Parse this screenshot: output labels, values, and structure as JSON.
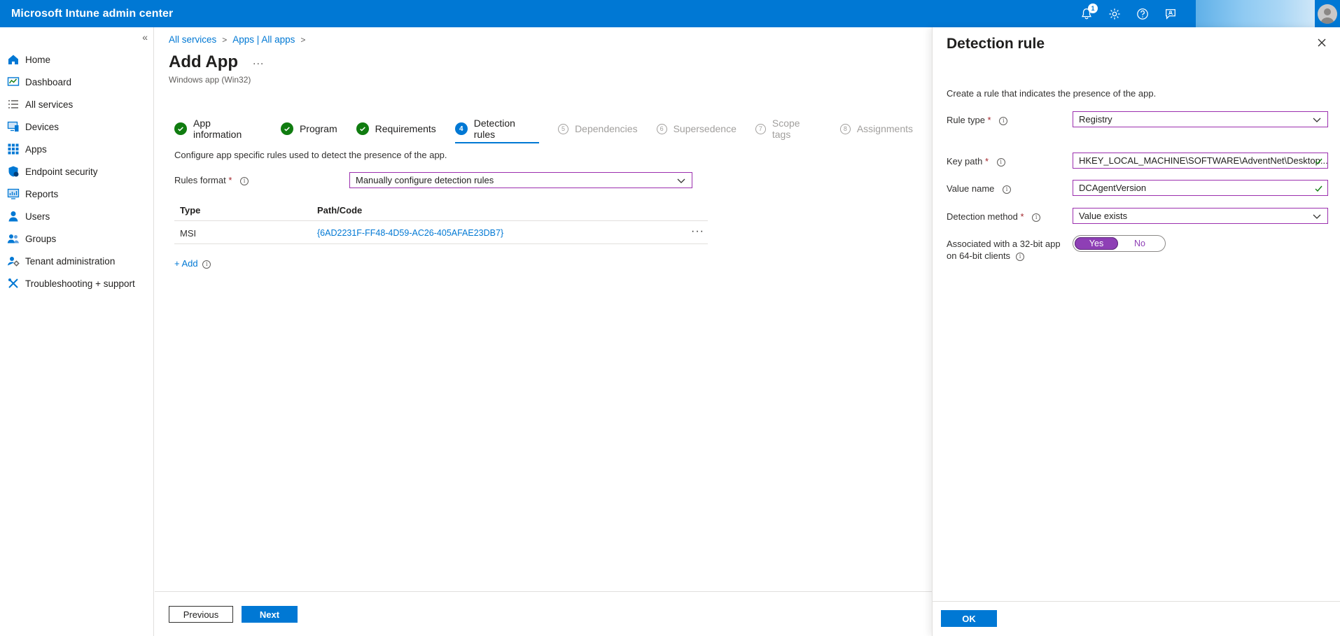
{
  "topbar": {
    "title": "Microsoft Intune admin center",
    "notification_count": "1",
    "icons": [
      "bell-icon",
      "gear-icon",
      "help-icon",
      "feedback-icon"
    ]
  },
  "sidebar": {
    "items": [
      {
        "label": "Home",
        "icon": "home-icon"
      },
      {
        "label": "Dashboard",
        "icon": "dashboard-icon"
      },
      {
        "label": "All services",
        "icon": "list-icon"
      },
      {
        "label": "Devices",
        "icon": "devices-icon"
      },
      {
        "label": "Apps",
        "icon": "apps-icon"
      },
      {
        "label": "Endpoint security",
        "icon": "shield-icon"
      },
      {
        "label": "Reports",
        "icon": "reports-icon"
      },
      {
        "label": "Users",
        "icon": "user-icon"
      },
      {
        "label": "Groups",
        "icon": "groups-icon"
      },
      {
        "label": "Tenant administration",
        "icon": "tenant-icon"
      },
      {
        "label": "Troubleshooting + support",
        "icon": "tools-icon"
      }
    ]
  },
  "breadcrumb": [
    "All services",
    "Apps | All apps"
  ],
  "page": {
    "title": "Add App",
    "subtitle": "Windows app (Win32)",
    "more": "..."
  },
  "steps": [
    {
      "label": "App information",
      "state": "done",
      "num": "1"
    },
    {
      "label": "Program",
      "state": "done",
      "num": "2"
    },
    {
      "label": "Requirements",
      "state": "done",
      "num": "3"
    },
    {
      "label": "Detection rules",
      "state": "active",
      "num": "4"
    },
    {
      "label": "Dependencies",
      "state": "future",
      "num": "5"
    },
    {
      "label": "Supersedence",
      "state": "future",
      "num": "6"
    },
    {
      "label": "Scope tags",
      "state": "future",
      "num": "7"
    },
    {
      "label": "Assignments",
      "state": "future",
      "num": "8"
    }
  ],
  "main": {
    "description": "Configure app specific rules used to detect the presence of the app.",
    "rules_format_label": "Rules format",
    "rules_format_value": "Manually configure detection rules",
    "table": {
      "headers": [
        "Type",
        "Path/Code"
      ],
      "rows": [
        {
          "type": "MSI",
          "path": "{6AD2231F-FF48-4D59-AC26-405AFAE23DB7}"
        }
      ]
    },
    "add_label": "+ Add"
  },
  "footer": {
    "previous": "Previous",
    "next": "Next"
  },
  "panel": {
    "title": "Detection rule",
    "description": "Create a rule that indicates the presence of the app.",
    "rule_type_label": "Rule type",
    "rule_type_value": "Registry",
    "key_path_label": "Key path",
    "key_path_value": "HKEY_LOCAL_MACHINE\\SOFTWARE\\AdventNet\\Desktop...",
    "value_name_label": "Value name",
    "value_name_value": "DCAgentVersion",
    "detection_method_label": "Detection method",
    "detection_method_value": "Value exists",
    "assoc_label_line1": "Associated with a 32-bit app",
    "assoc_label_line2": "on 64-bit clients",
    "toggle_yes": "Yes",
    "toggle_no": "No",
    "ok": "OK"
  },
  "colors": {
    "brand": "#0078d4",
    "done": "#107c10",
    "focus_border": "#9b2fae",
    "toggle_on": "#8e3fb5"
  }
}
